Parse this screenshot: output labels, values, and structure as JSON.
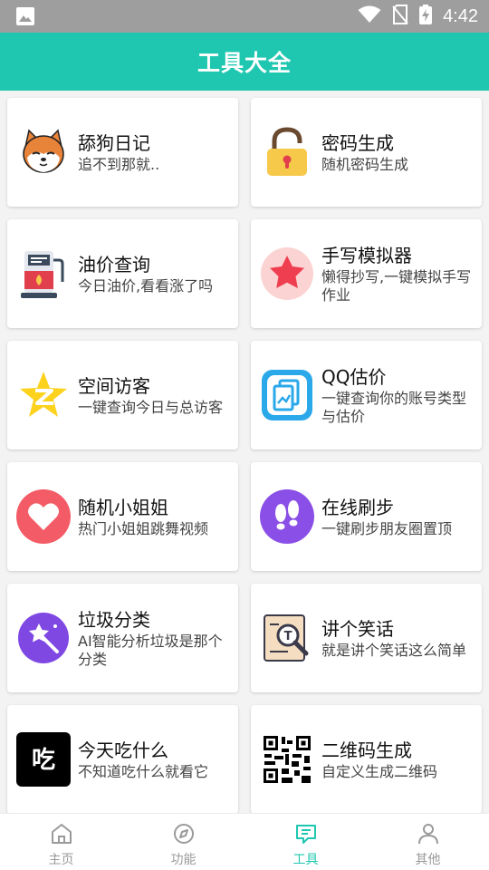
{
  "status_bar": {
    "time": "4:42",
    "icons": [
      "gallery-icon",
      "wifi-icon",
      "no-sim-icon",
      "battery-icon"
    ]
  },
  "app_bar": {
    "title": "工具大全",
    "color": "#1fc7b0"
  },
  "tools": [
    {
      "name": "舔狗日记",
      "desc": "追不到那就..",
      "icon": "shiba-dog-icon"
    },
    {
      "name": "密码生成",
      "desc": "随机密码生成",
      "icon": "padlock-icon"
    },
    {
      "name": "油价查询",
      "desc": "今日油价,看看涨了吗",
      "icon": "fuel-pump-icon"
    },
    {
      "name": "手写模拟器",
      "desc": "懒得抄写,一键模拟手写作业",
      "icon": "star-badge-icon"
    },
    {
      "name": "空间访客",
      "desc": "一键查询今日与总访客",
      "icon": "qzone-star-icon"
    },
    {
      "name": "QQ估价",
      "desc": "一键查询你的账号类型与估价",
      "icon": "document-chart-icon"
    },
    {
      "name": "随机小姐姐",
      "desc": "热门小姐姐跳舞视频",
      "icon": "heart-icon"
    },
    {
      "name": "在线刷步",
      "desc": "一键刷步朋友圈置顶",
      "icon": "footprints-icon"
    },
    {
      "name": "垃圾分类",
      "desc": "AI智能分析垃圾是那个分类",
      "icon": "magic-wand-icon"
    },
    {
      "name": "讲个笑话",
      "desc": "就是讲个笑话这么简单",
      "icon": "magnifier-book-icon"
    },
    {
      "name": "今天吃什么",
      "desc": "不知道吃什么就看它",
      "icon": "eat-badge-icon",
      "glyph": "吃"
    },
    {
      "name": "二维码生成",
      "desc": "自定义生成二维码",
      "icon": "qr-code-icon"
    }
  ],
  "bottom_nav": {
    "active": "工具",
    "tabs": [
      {
        "label": "主页",
        "icon": "home-icon"
      },
      {
        "label": "功能",
        "icon": "compass-icon"
      },
      {
        "label": "工具",
        "icon": "message-icon"
      },
      {
        "label": "其他",
        "icon": "person-icon"
      }
    ]
  }
}
